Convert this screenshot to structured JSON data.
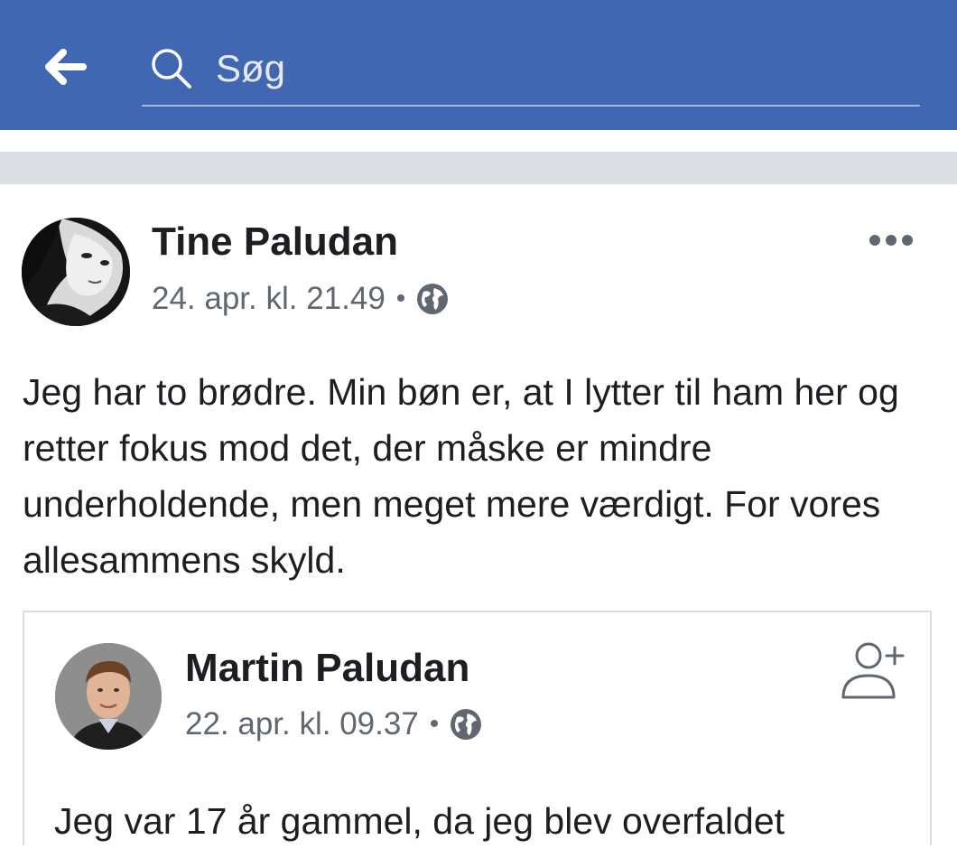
{
  "header": {
    "back_icon": "arrow-left-icon",
    "search_icon": "search-icon",
    "search_placeholder": "Søg",
    "background_color": "#4267b2"
  },
  "post": {
    "author": "Tine Paludan",
    "date": "24. apr. kl. 21.49",
    "separator": "•",
    "privacy_icon": "globe-icon",
    "more_icon": "more-horizontal-icon",
    "text": "Jeg har to brødre. Min bøn er, at I lytter til ham her og retter fokus mod det, der måske er mindre underholdende, men meget mere værdigt. For vores allesammens skyld."
  },
  "shared_post": {
    "author": "Martin Paludan",
    "date": "22. apr. kl. 09.37",
    "separator": "•",
    "privacy_icon": "globe-icon",
    "add_friend_icon": "add-friend-icon",
    "text": "Jeg var 17 år gammel, da jeg blev overfaldet"
  },
  "colors": {
    "brand": "#4267b2",
    "text": "#1c1e21",
    "meta": "#606770",
    "divider": "#dadde1"
  }
}
